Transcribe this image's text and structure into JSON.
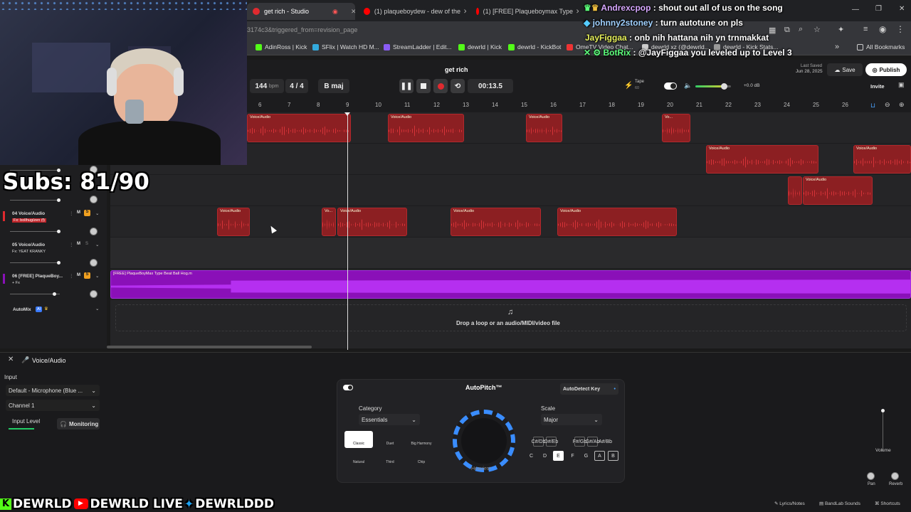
{
  "browser": {
    "tabs": [
      {
        "label": "get rich - Studio",
        "active": true
      },
      {
        "label": "(1) plaqueboydew - dew of the",
        "active": false
      },
      {
        "label": "(1) [FREE] Plaqueboymax Type",
        "active": false
      }
    ],
    "url": "3174c3&triggered_from=revision_page",
    "bookmarks": [
      "AdinRoss | Kick",
      "SFlix | Watch HD M...",
      "StreamLadder | Edit...",
      "dewrld | Kick",
      "dewrld - KickBot",
      "OmeTV Video Chat...",
      "dewrld xz (@dewrld...",
      "dewrld - Kick Stats..."
    ],
    "all_bookmarks": "All Bookmarks"
  },
  "chat": [
    {
      "user": "Andrexcpop",
      "msg": ": shout out all of us on the song"
    },
    {
      "user": "johnny2stoney",
      "msg": ": turn autotune on pls"
    },
    {
      "user": "JayFiggaa",
      "msg": ": onb nih hattana nih yn trnmakkat"
    },
    {
      "user": "BotRix",
      "msg": ": @JayFiggaa you leveled up to Level 3"
    }
  ],
  "overlay": {
    "subs": "Subs: 81/90",
    "socials": [
      "DEWRLD",
      "DEWRLD LIVE",
      "DEWRLDDD"
    ]
  },
  "studio": {
    "project_title": "get rich",
    "last_saved_label": "Last Saved",
    "last_saved_date": "Jun 28, 2025",
    "save": "Save",
    "publish": "Publish",
    "invite": "Invite",
    "bpm": "144",
    "bpm_unit": "bpm",
    "time_sig": "4 / 4",
    "key": "B maj",
    "time": "00:13.5",
    "tape_label": "Tape",
    "tape_value": "60",
    "volume_db": "+0.0 dB",
    "ruler": [
      "6",
      "7",
      "8",
      "9",
      "10",
      "11",
      "12",
      "13",
      "14",
      "15",
      "16",
      "17",
      "18",
      "19",
      "20",
      "21",
      "22",
      "23",
      "24",
      "25",
      "26"
    ],
    "tracks": [
      {
        "num": "04",
        "name": "Voice/Audio",
        "fx": "Fx: bollhug/zen (f)"
      },
      {
        "num": "05",
        "name": "Voice/Audio",
        "fx": "Fx: YEAT KRANKY"
      },
      {
        "num": "06",
        "name": "[FREE] PlaqueBoy...",
        "fx": "+ Fx"
      }
    ],
    "automix": "AutoMix",
    "ai_badge": "AI",
    "clip_label": "Voice/Audio",
    "clip_label_short": "Vo...",
    "beat_clip_label": "[FREE] PlaqueBoyMax Type Beat Ball Hog.m",
    "drop_text": "Drop a loop or an audio/MIDI/video file"
  },
  "panel": {
    "track_name": "Voice/Audio",
    "input_label": "Input",
    "input_device": "Default - Microphone (Blue ...",
    "channel": "Channel 1",
    "input_level": "Input Level",
    "monitoring": "Monitoring",
    "autopitch_title": "AutoPitch™",
    "autodetect": "AutoDetect Key",
    "category_label": "Category",
    "category_value": "Essentials",
    "scale_label": "Scale",
    "scale_value": "Major",
    "modes": [
      "Classic",
      "Duet",
      "Big Harmony",
      "Natural",
      "Third",
      "Chip"
    ],
    "knob_label": "Heaviest",
    "sharps": [
      "C#/Db",
      "D#/Eb",
      "F#/Gb",
      "G#/Ab",
      "A#/Bb"
    ],
    "keys": [
      "C",
      "D",
      "E",
      "F",
      "G",
      "A",
      "B"
    ],
    "volume": "Volume",
    "pan": "Pan",
    "reverb": "Reverb"
  },
  "footer": {
    "lyrics": "Lyrics/Notes",
    "sounds": "BandLab Sounds",
    "shortcuts": "Shortcuts"
  },
  "colors": {
    "clip_red": "#8c1f22",
    "clip_purple": "#8a10b8",
    "accent_red": "#e02a2f"
  }
}
